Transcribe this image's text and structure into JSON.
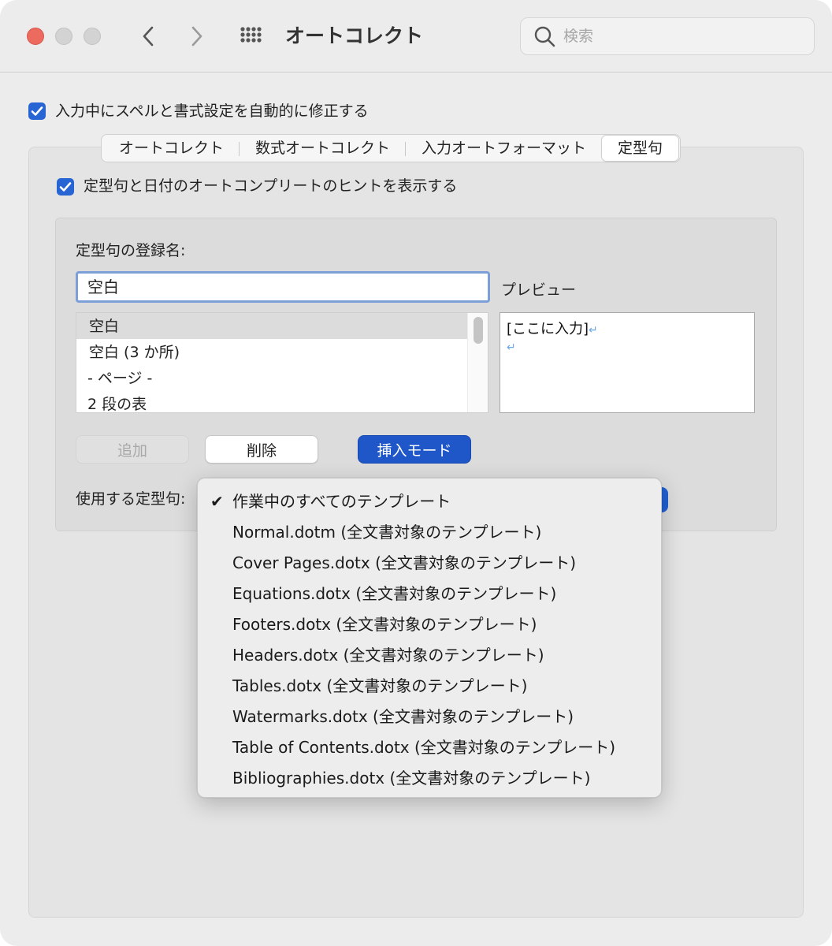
{
  "window": {
    "title": "オートコレクト"
  },
  "search": {
    "placeholder": "検索"
  },
  "main_checkbox": {
    "label": "入力中にスペルと書式設定を自動的に修正する",
    "checked": true
  },
  "tabs": [
    {
      "label": "オートコレクト",
      "active": false
    },
    {
      "label": "数式オートコレクト",
      "active": false
    },
    {
      "label": "入力オートフォーマット",
      "active": false
    },
    {
      "label": "定型句",
      "active": true
    }
  ],
  "hint_checkbox": {
    "label": "定型句と日付のオートコンプリートのヒントを表示する",
    "checked": true
  },
  "entry": {
    "name_label": "定型句の登録名:",
    "name_value": "空白",
    "preview_label": "プレビュー",
    "preview_text": "[ここに入力]",
    "items": [
      "空白",
      "空白 (3 か所)",
      "- ページ -",
      "2 段の表"
    ],
    "selected_index": 0
  },
  "buttons": {
    "add": "追加",
    "delete": "削除",
    "insert_mode": "挿入モード"
  },
  "template_select": {
    "label": "使用する定型句:",
    "options": [
      "作業中のすべてのテンプレート",
      "Normal.dotm (全文書対象のテンプレート)",
      "Cover Pages.dotx (全文書対象のテンプレート)",
      "Equations.dotx (全文書対象のテンプレート)",
      "Footers.dotx (全文書対象のテンプレート)",
      "Headers.dotx (全文書対象のテンプレート)",
      "Tables.dotx (全文書対象のテンプレート)",
      "Watermarks.dotx (全文書対象のテンプレート)",
      "Table of Contents.dotx (全文書対象のテンプレート)",
      "Bibliographies.dotx (全文書対象のテンプレート)"
    ],
    "selected_index": 0,
    "check_glyph": "✔"
  },
  "colors": {
    "accent": "#2764d4",
    "close": "#ed6a5e"
  },
  "icons": {
    "back": "chevron-left-icon",
    "forward": "chevron-right-icon",
    "grid": "grid-icon",
    "search": "magnifier-icon"
  }
}
